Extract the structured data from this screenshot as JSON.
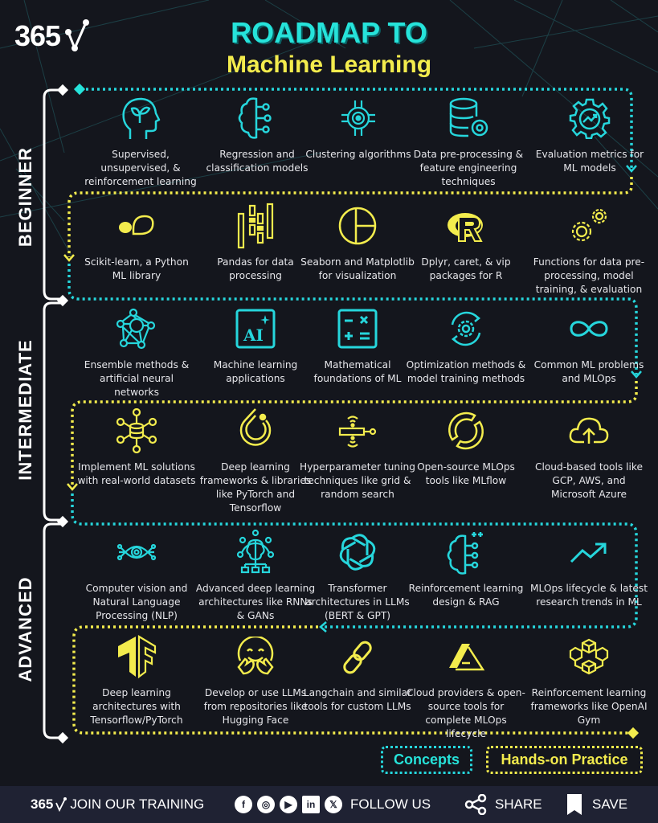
{
  "header": {
    "brand": "365",
    "title_line1": "ROADMAP TO",
    "title_line2": "Machine Learning"
  },
  "colors": {
    "background": "#14161d",
    "concepts": "#26e3da",
    "hands_on": "#f3ec4d",
    "footer_bg": "#1f2233"
  },
  "levels": [
    {
      "label": "BEGINNER"
    },
    {
      "label": "INTERMEDIATE"
    },
    {
      "label": "ADVANCED"
    }
  ],
  "rows": [
    {
      "type": "concepts",
      "items": [
        {
          "icon": "head-sprout-icon",
          "label": "Supervised, unsupervised, & reinforcement learning"
        },
        {
          "icon": "brain-circuit-icon",
          "label": "Regression and classification models"
        },
        {
          "icon": "gear-circuit-icon",
          "label": "Clustering algorithms"
        },
        {
          "icon": "database-gear-icon",
          "label": "Data pre-processing & feature engineering techniques"
        },
        {
          "icon": "gear-chart-icon",
          "label": "Evaluation metrics for ML models"
        }
      ]
    },
    {
      "type": "hands_on",
      "items": [
        {
          "icon": "scikit-learn-icon",
          "label": "Scikit-learn, a Python ML library"
        },
        {
          "icon": "pandas-icon",
          "label": "Pandas for data processing"
        },
        {
          "icon": "pie-chart-icon",
          "label": "Seaborn and Matplotlib for visualization"
        },
        {
          "icon": "r-logo-icon",
          "label": "Dplyr, caret, & vip packages for R"
        },
        {
          "icon": "gears-icon",
          "label": "Functions for data pre-processing, model training, & evaluation"
        }
      ]
    },
    {
      "type": "concepts",
      "items": [
        {
          "icon": "neural-network-icon",
          "label": "Ensemble methods & artificial neural networks"
        },
        {
          "icon": "ai-sparkle-icon",
          "label": "Machine learning applications"
        },
        {
          "icon": "calculator-icon",
          "label": "Mathematical foundations of ML"
        },
        {
          "icon": "gear-cycle-icon",
          "label": "Optimization methods & model training methods"
        },
        {
          "icon": "infinity-icon",
          "label": "Common ML problems and MLOps"
        }
      ]
    },
    {
      "type": "hands_on",
      "items": [
        {
          "icon": "database-network-icon",
          "label": "Implement ML solutions with real-world datasets"
        },
        {
          "icon": "pytorch-icon",
          "label": "Deep learning frameworks & libraries like PyTorch and Tensorflow"
        },
        {
          "icon": "tuning-slider-icon",
          "label": "Hyperparameter tuning techniques like grid & random search"
        },
        {
          "icon": "mlflow-icon",
          "label": "Open-source MLOps tools like MLflow"
        },
        {
          "icon": "cloud-upload-icon",
          "label": "Cloud-based tools like GCP, AWS, and Microsoft Azure"
        }
      ]
    },
    {
      "type": "concepts",
      "items": [
        {
          "icon": "eye-circuit-icon",
          "label": "Computer vision and Natural Language Processing (NLP)"
        },
        {
          "icon": "brain-network-icon",
          "label": "Advanced deep learning architectures like RNNs & GANs"
        },
        {
          "icon": "openai-icon",
          "label": "Transformer architectures in LLMs (BERT & GPT)"
        },
        {
          "icon": "brain-plus-icon",
          "label": "Reinforcement learning design & RAG"
        },
        {
          "icon": "trend-up-icon",
          "label": "MLOps lifecycle & latest research trends in ML"
        }
      ]
    },
    {
      "type": "hands_on",
      "items": [
        {
          "icon": "tensorflow-icon",
          "label": "Deep learning architectures with Tensorflow/PyTorch"
        },
        {
          "icon": "hugging-face-icon",
          "label": "Develop or use  LLMs from repositories like Hugging Face"
        },
        {
          "icon": "chain-link-icon",
          "label": "Langchain and similar tools for custom LLMs"
        },
        {
          "icon": "azure-icon",
          "label": "Cloud providers & open-source tools for complete MLOps lifecycle"
        },
        {
          "icon": "openai-gym-icon",
          "label": "Reinforcement learning frameworks like OpenAI Gym"
        }
      ]
    }
  ],
  "legend": {
    "concepts": "Concepts",
    "hands_on": "Hands-on Practice"
  },
  "footer": {
    "brand": "365",
    "join": "JOIN OUR TRAINING",
    "social_icons": [
      "facebook-icon",
      "instagram-icon",
      "youtube-icon",
      "linkedin-icon",
      "x-icon"
    ],
    "follow": "FOLLOW US",
    "share": "SHARE",
    "save": "SAVE"
  }
}
